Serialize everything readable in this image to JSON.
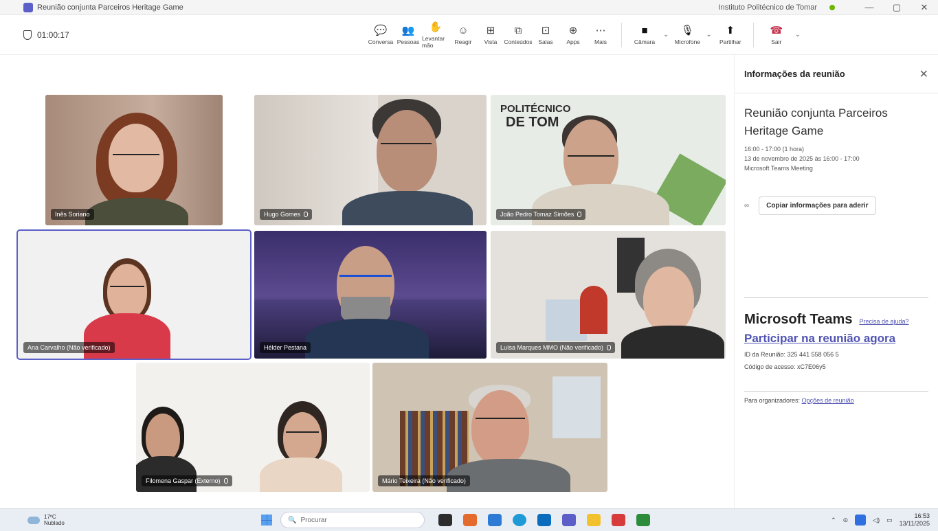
{
  "window": {
    "title": "Reunião conjunta Parceiros Heritage Game",
    "org": "Instituto Politécnico de Tomar",
    "minimize": "—",
    "maximize": "▢",
    "close": "✕"
  },
  "toolbar": {
    "timer": "01:00:17",
    "buttons": [
      {
        "label": "Conversa",
        "icon": "chat-icon",
        "glyph": "💬"
      },
      {
        "label": "Pessoas",
        "icon": "people-icon",
        "glyph": "👥"
      },
      {
        "label": "Levantar mão",
        "icon": "hand-icon",
        "glyph": "✋"
      },
      {
        "label": "Reagir",
        "icon": "emoji-icon",
        "glyph": "☺"
      },
      {
        "label": "Vista",
        "icon": "grid-icon",
        "glyph": "⊞"
      },
      {
        "label": "Conteúdos",
        "icon": "share-icon",
        "glyph": "⧉"
      },
      {
        "label": "Salas",
        "icon": "rooms-icon",
        "glyph": "⊡"
      },
      {
        "label": "Apps",
        "icon": "apps-icon",
        "glyph": "⊕"
      },
      {
        "label": "Mais",
        "icon": "more-icon",
        "glyph": "⋯"
      }
    ],
    "camera": {
      "label": "Câmara",
      "glyph": "■"
    },
    "mic": {
      "label": "Microfone",
      "glyph": "🎙"
    },
    "share": {
      "label": "Partilhar",
      "glyph": "⬆"
    },
    "leave": {
      "label": "Sair",
      "glyph": "☎"
    }
  },
  "participants": [
    {
      "name": "Inês Soriano",
      "mic": false
    },
    {
      "name": "Hugo Gomes",
      "mic": true
    },
    {
      "name": "João Pedro Tomaz Simões",
      "mic": true
    },
    {
      "name": "Ana Carvalho (Não verificado)",
      "mic": false
    },
    {
      "name": "Hélder Pestana",
      "mic": false
    },
    {
      "name": "Luísa Marques MMO (Não verificado)",
      "mic": true
    },
    {
      "name": "Filomena Gaspar (Externo)",
      "mic": true
    },
    {
      "name": "Mário Teixeira (Não verificado)",
      "mic": false
    }
  ],
  "backdrop": {
    "banner_line1": "POLITÉCNICO",
    "banner_line2": "DE TOM"
  },
  "panel": {
    "header": "Informações da reunião",
    "meeting_title": "Reunião conjunta Parceiros Heritage Game",
    "time": "16:00 - 17:00 (1 hora)",
    "date": "13 de novembro de 2025 às 16:00 - 17:00",
    "type": "Microsoft Teams Meeting",
    "copy_button": "Copiar informações para aderir",
    "teams_heading": "Microsoft Teams",
    "help_link": "Precisa de ajuda?",
    "join_link": "Participar na reunião agora",
    "meeting_id": "ID da Reunião: 325 441 558 056 5",
    "passcode": "Código de acesso: xC7E06y5",
    "organizers_prefix": "Para organizadores:",
    "organizers_link": "Opções de reunião"
  },
  "taskbar": {
    "temp": "17ºC",
    "weather": "Nublado",
    "search_placeholder": "Procurar",
    "time": "16:53",
    "date": "13/11/2025"
  }
}
